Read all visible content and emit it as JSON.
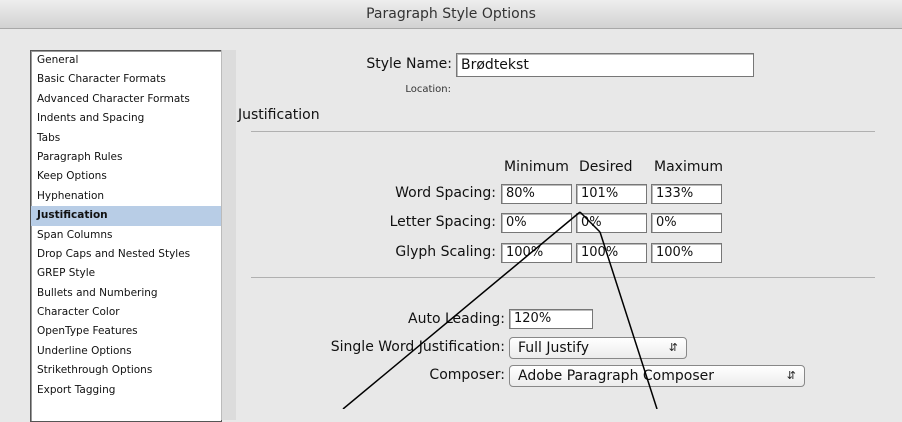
{
  "window": {
    "title": "Paragraph Style Options"
  },
  "sidebar": {
    "items": [
      {
        "label": "General"
      },
      {
        "label": "Basic Character Formats"
      },
      {
        "label": "Advanced Character Formats"
      },
      {
        "label": "Indents and Spacing"
      },
      {
        "label": "Tabs"
      },
      {
        "label": "Paragraph Rules"
      },
      {
        "label": "Keep Options"
      },
      {
        "label": "Hyphenation"
      },
      {
        "label": "Justification",
        "selected": true
      },
      {
        "label": "Span Columns"
      },
      {
        "label": "Drop Caps and Nested Styles"
      },
      {
        "label": "GREP Style"
      },
      {
        "label": "Bullets and Numbering"
      },
      {
        "label": "Character Color"
      },
      {
        "label": "OpenType Features"
      },
      {
        "label": "Underline Options"
      },
      {
        "label": "Strikethrough Options"
      },
      {
        "label": "Export Tagging"
      }
    ]
  },
  "style": {
    "name_label": "Style Name:",
    "name_value": "Brødtekst",
    "location_label": "Location:"
  },
  "section": {
    "title": "Justification"
  },
  "columns": {
    "minimum": "Minimum",
    "desired": "Desired",
    "maximum": "Maximum"
  },
  "rows": {
    "word_spacing": {
      "label": "Word Spacing:",
      "min": "80%",
      "desired": "101%",
      "max": "133%"
    },
    "letter_spacing": {
      "label": "Letter Spacing:",
      "min": "0%",
      "desired": "0%",
      "max": "0%"
    },
    "glyph_scaling": {
      "label": "Glyph Scaling:",
      "min": "100%",
      "desired": "100%",
      "max": "100%"
    }
  },
  "auto_leading": {
    "label": "Auto Leading:",
    "value": "120%"
  },
  "single_word": {
    "label": "Single Word Justification:",
    "value": "Full Justify"
  },
  "composer": {
    "label": "Composer:",
    "value": "Adobe Paragraph Composer"
  },
  "icons": {
    "popup_arrows": "updown-chevron-icon"
  }
}
